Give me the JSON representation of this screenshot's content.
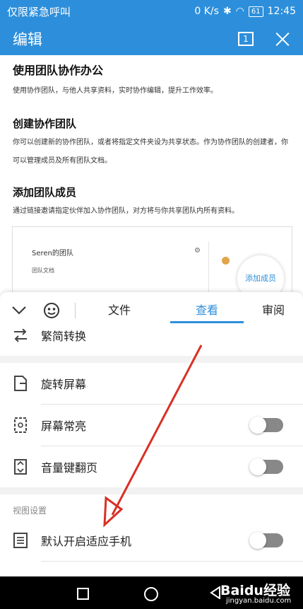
{
  "status_bar": {
    "carrier": "仅限紧急呼叫",
    "network_speed": "0 K/s",
    "battery": "61",
    "time": "12:45"
  },
  "title_bar": {
    "title": "编辑",
    "page_count": "1"
  },
  "document": {
    "heading1": "使用团队协作办公",
    "para1": "使用协作团队，与他人共享资料，实时协作编辑，提升工作效率。",
    "heading2": "创建协作团队",
    "para2": "你可以创建新的协作团队，或者将指定文件夹设为共享状态。作为协作团队的创建者，你可以管理成员及所有团队文档。",
    "heading3": "添加团队成员",
    "para3": "通过链接邀请指定伙伴加入协作团队，对方将与你共享团队内所有资料。",
    "preview": {
      "team_name": "Seren的团队",
      "team_docs": "团队文档",
      "add_member": "添加成员"
    }
  },
  "tabbar": {
    "tabs": [
      {
        "label": "文件",
        "active": false
      },
      {
        "label": "查看",
        "active": true
      },
      {
        "label": "审阅",
        "active": false
      }
    ]
  },
  "menu": {
    "items": [
      {
        "label": "繁简转换",
        "icon": "convert-icon"
      },
      {
        "label": "旋转屏幕",
        "icon": "rotate-screen-icon"
      },
      {
        "label": "屏幕常亮",
        "icon": "screen-brightness-icon",
        "toggle_on": false
      },
      {
        "label": "音量键翻页",
        "icon": "volume-page-icon",
        "toggle_on": false
      }
    ],
    "section_header": "视图设置",
    "view_items": [
      {
        "label": "默认开启适应手机",
        "icon": "fit-phone-icon",
        "toggle_on": false
      }
    ]
  },
  "watermark": {
    "brand": "Baidu经验",
    "url": "jingyan.baidu.com"
  },
  "colors": {
    "accent": "#2d8fdb",
    "arrow": "#d93025"
  }
}
